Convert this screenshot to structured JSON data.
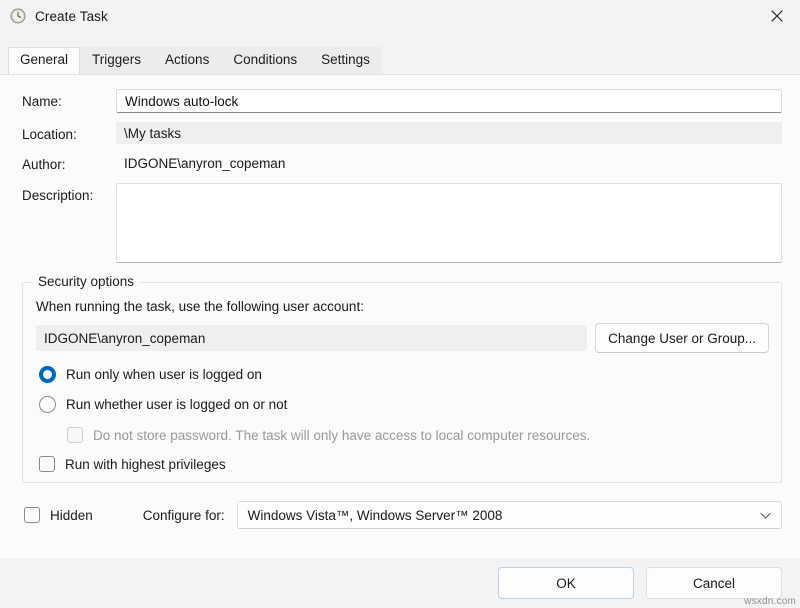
{
  "window": {
    "title": "Create Task",
    "icon": "clock-task-icon",
    "close_label": "✕",
    "accent_color": "#0067c0",
    "background_color": "#f3f3f3",
    "panel_color": "#fbfbfb"
  },
  "tabs": [
    {
      "label": "General",
      "active": true
    },
    {
      "label": "Triggers",
      "active": false
    },
    {
      "label": "Actions",
      "active": false
    },
    {
      "label": "Conditions",
      "active": false
    },
    {
      "label": "Settings",
      "active": false
    }
  ],
  "general": {
    "name_label": "Name:",
    "name_value": "Windows auto-lock",
    "location_label": "Location:",
    "location_value": "\\My tasks",
    "author_label": "Author:",
    "author_value": "IDGONE\\anyron_copeman",
    "description_label": "Description:",
    "description_value": ""
  },
  "security": {
    "group_title": "Security options",
    "account_prompt": "When running the task, use the following user account:",
    "account_value": "IDGONE\\anyron_copeman",
    "change_user_button": "Change User or Group...",
    "options": [
      {
        "label": "Run only when user is logged on",
        "type": "radio",
        "checked": true,
        "disabled": false
      },
      {
        "label": "Run whether user is logged on or not",
        "type": "radio",
        "checked": false,
        "disabled": false
      },
      {
        "label": "Do not store password.  The task will only have access to local computer resources.",
        "type": "checkbox",
        "checked": false,
        "disabled": true
      },
      {
        "label": "Run with highest privileges",
        "type": "checkbox",
        "checked": false,
        "disabled": false
      }
    ]
  },
  "bottom": {
    "hidden_label": "Hidden",
    "hidden_checked": false,
    "configure_label": "Configure for:",
    "configure_value": "Windows Vista™, Windows Server™ 2008",
    "chevron": "chevron-down-icon"
  },
  "footer": {
    "ok_label": "OK",
    "cancel_label": "Cancel"
  },
  "watermark": "wsxdn.com"
}
